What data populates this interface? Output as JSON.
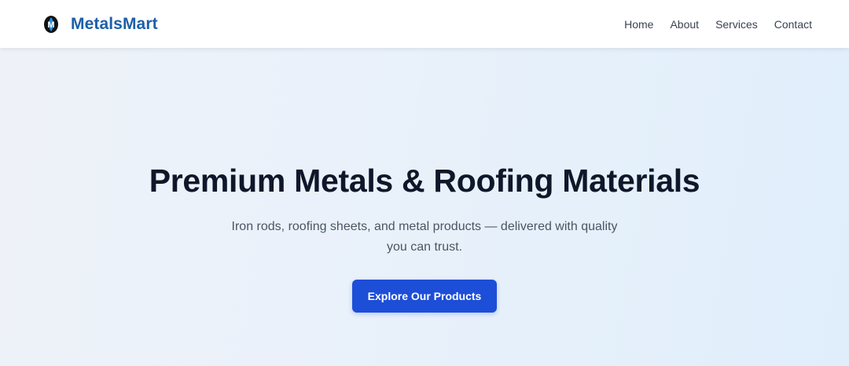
{
  "header": {
    "brand_name": "MetalsMart",
    "logo_icon": "metalsmart-logo-icon",
    "nav": [
      {
        "label": "Home"
      },
      {
        "label": "About"
      },
      {
        "label": "Services"
      },
      {
        "label": "Contact"
      }
    ]
  },
  "hero": {
    "title": "Premium Metals & Roofing Materials",
    "subtitle": "Iron rods, roofing sheets, and metal products — delivered with quality you can trust.",
    "cta_label": "Explore Our Products"
  },
  "colors": {
    "brand": "#1d5fa8",
    "accent": "#1d4ed8",
    "title_text": "#0f172a",
    "hero_background": "#e9f1fa"
  }
}
